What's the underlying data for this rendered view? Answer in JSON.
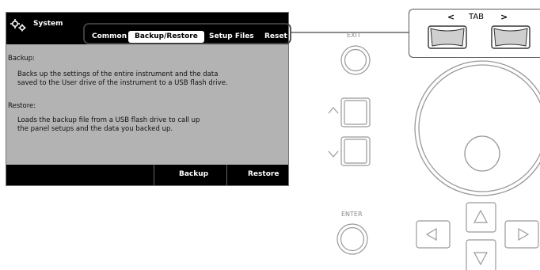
{
  "screen": {
    "title": "System",
    "tabs": [
      "Common",
      "Backup/Restore",
      "Setup Files",
      "Reset"
    ],
    "active_tab": "Backup/Restore",
    "backup": {
      "heading": "Backup:",
      "line1": "Backs up the settings of the entire instrument and the data",
      "line2": "saved to the User drive of the instrument to a USB flash drive."
    },
    "restore": {
      "heading": "Restore:",
      "line1": "Loads the backup file from a USB flash drive to call up",
      "line2": "the panel setups and the data you backed up."
    },
    "softkeys": {
      "backup": "Backup",
      "restore": "Restore"
    }
  },
  "panel": {
    "tab_left": "<",
    "tab_label": "TAB",
    "tab_right": ">",
    "exit_label": "EXIT",
    "enter_label": "ENTER"
  },
  "colors": {
    "lcd_background": "#b3b3b3",
    "bar_background": "#000000",
    "panel_line": "#888888"
  }
}
